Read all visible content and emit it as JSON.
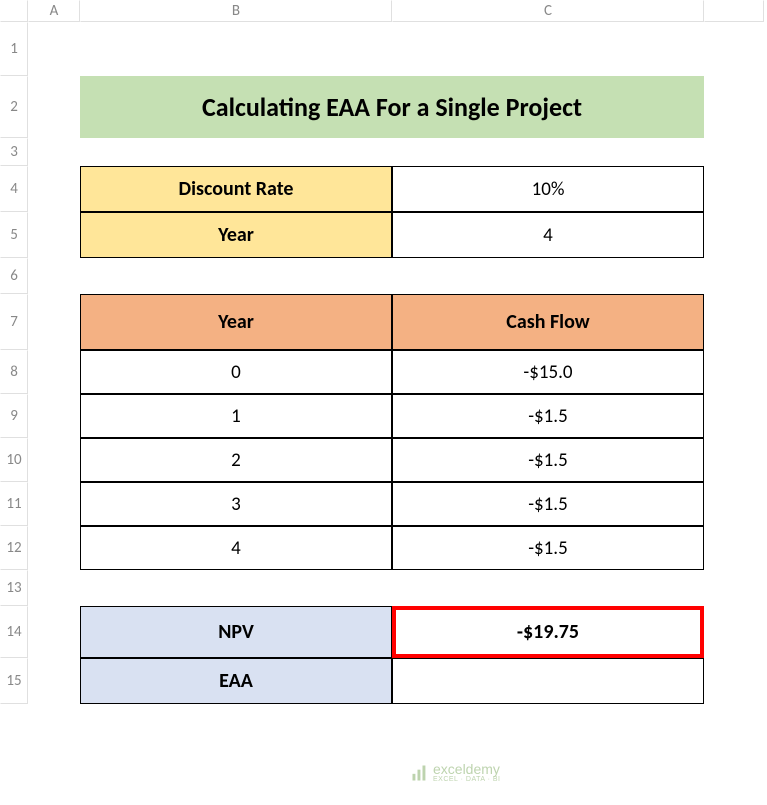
{
  "columns": [
    "A",
    "B",
    "C"
  ],
  "rows": [
    "1",
    "2",
    "3",
    "4",
    "5",
    "6",
    "7",
    "8",
    "9",
    "10",
    "11",
    "12",
    "13",
    "14",
    "15"
  ],
  "title": "Calculating EAA For a Single Project",
  "params": {
    "discount_rate_label": "Discount Rate",
    "discount_rate_value": "10%",
    "year_label": "Year",
    "year_value": "4"
  },
  "table": {
    "header_year": "Year",
    "header_cashflow": "Cash Flow",
    "rows": [
      {
        "year": "0",
        "cashflow": "-$15.0"
      },
      {
        "year": "1",
        "cashflow": "-$1.5"
      },
      {
        "year": "2",
        "cashflow": "-$1.5"
      },
      {
        "year": "3",
        "cashflow": "-$1.5"
      },
      {
        "year": "4",
        "cashflow": "-$1.5"
      }
    ]
  },
  "results": {
    "npv_label": "NPV",
    "npv_value": "-$19.75",
    "eaa_label": "EAA"
  },
  "watermark": {
    "main": "exceldemy",
    "sub": "EXCEL · DATA · BI"
  },
  "chart_data": {
    "type": "table",
    "title": "Calculating EAA For a Single Project",
    "parameters": {
      "discount_rate": 0.1,
      "years": 4
    },
    "cash_flows": [
      {
        "year": 0,
        "value": -15.0
      },
      {
        "year": 1,
        "value": -1.5
      },
      {
        "year": 2,
        "value": -1.5
      },
      {
        "year": 3,
        "value": -1.5
      },
      {
        "year": 4,
        "value": -1.5
      }
    ],
    "npv": -19.75
  }
}
